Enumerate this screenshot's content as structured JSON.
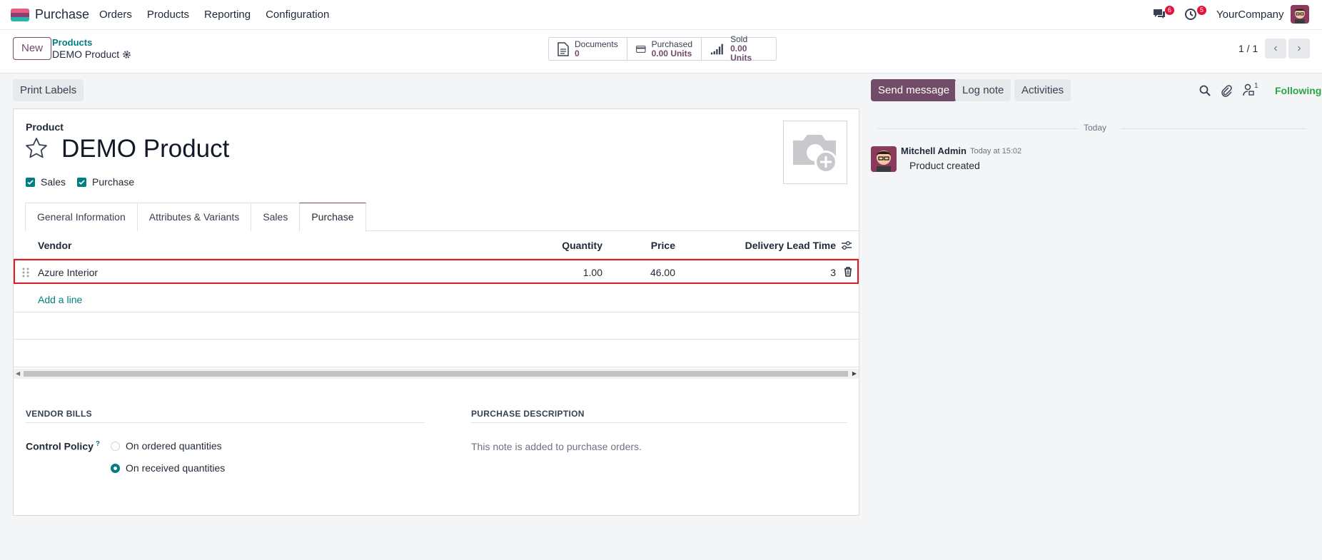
{
  "navbar": {
    "app_name": "Purchase",
    "menu": [
      "Orders",
      "Products",
      "Reporting",
      "Configuration"
    ],
    "chat_badge": "6",
    "activity_badge": "5",
    "company": "YourCompany"
  },
  "control_panel": {
    "new_label": "New",
    "breadcrumb_parent": "Products",
    "breadcrumb_current": "DEMO Product",
    "smart_buttons": [
      {
        "label": "Documents",
        "value": "0"
      },
      {
        "label": "Purchased",
        "value": "0.00 Units"
      },
      {
        "label": "Sold",
        "value": "0.00 Units"
      }
    ],
    "pager": "1 / 1"
  },
  "actions": {
    "print_labels": "Print Labels"
  },
  "form": {
    "product_label": "Product",
    "product_name": "DEMO Product",
    "checkboxes": [
      {
        "label": "Sales",
        "checked": true
      },
      {
        "label": "Purchase",
        "checked": true
      }
    ],
    "tabs": [
      "General Information",
      "Attributes & Variants",
      "Sales",
      "Purchase"
    ],
    "active_tab": "Purchase",
    "vendor_list": {
      "columns": [
        "Vendor",
        "Quantity",
        "Price",
        "Delivery Lead Time"
      ],
      "rows": [
        {
          "vendor": "Azure Interior",
          "quantity": "1.00",
          "price": "46.00",
          "lead_time": "3"
        }
      ],
      "add_line": "Add a line"
    },
    "vendor_bills": {
      "title": "VENDOR BILLS",
      "control_policy_label": "Control Policy",
      "help_mark": "?",
      "options": [
        {
          "label": "On ordered quantities",
          "selected": false
        },
        {
          "label": "On received quantities",
          "selected": true
        }
      ]
    },
    "purchase_description": {
      "title": "PURCHASE DESCRIPTION",
      "placeholder": "This note is added to purchase orders."
    }
  },
  "chatter": {
    "send_message": "Send message",
    "log_note": "Log note",
    "activities": "Activities",
    "followers_count": "1",
    "following": "Following",
    "today": "Today",
    "message": {
      "author": "Mitchell Admin",
      "date": "Today at 15:02",
      "body": "Product created"
    }
  },
  "colors": {
    "brand": "#714b67",
    "teal": "#017e84",
    "highlight": "#e11b22",
    "following": "#28a745"
  }
}
